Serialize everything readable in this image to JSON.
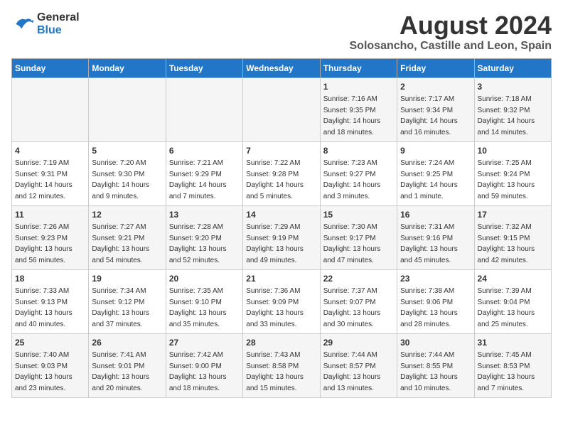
{
  "logo": {
    "line1": "General",
    "line2": "Blue"
  },
  "title": "August 2024",
  "subtitle": "Solosancho, Castille and Leon, Spain",
  "headers": [
    "Sunday",
    "Monday",
    "Tuesday",
    "Wednesday",
    "Thursday",
    "Friday",
    "Saturday"
  ],
  "weeks": [
    [
      {
        "day": "",
        "info": ""
      },
      {
        "day": "",
        "info": ""
      },
      {
        "day": "",
        "info": ""
      },
      {
        "day": "",
        "info": ""
      },
      {
        "day": "1",
        "info": "Sunrise: 7:16 AM\nSunset: 9:35 PM\nDaylight: 14 hours\nand 18 minutes."
      },
      {
        "day": "2",
        "info": "Sunrise: 7:17 AM\nSunset: 9:34 PM\nDaylight: 14 hours\nand 16 minutes."
      },
      {
        "day": "3",
        "info": "Sunrise: 7:18 AM\nSunset: 9:32 PM\nDaylight: 14 hours\nand 14 minutes."
      }
    ],
    [
      {
        "day": "4",
        "info": "Sunrise: 7:19 AM\nSunset: 9:31 PM\nDaylight: 14 hours\nand 12 minutes."
      },
      {
        "day": "5",
        "info": "Sunrise: 7:20 AM\nSunset: 9:30 PM\nDaylight: 14 hours\nand 9 minutes."
      },
      {
        "day": "6",
        "info": "Sunrise: 7:21 AM\nSunset: 9:29 PM\nDaylight: 14 hours\nand 7 minutes."
      },
      {
        "day": "7",
        "info": "Sunrise: 7:22 AM\nSunset: 9:28 PM\nDaylight: 14 hours\nand 5 minutes."
      },
      {
        "day": "8",
        "info": "Sunrise: 7:23 AM\nSunset: 9:27 PM\nDaylight: 14 hours\nand 3 minutes."
      },
      {
        "day": "9",
        "info": "Sunrise: 7:24 AM\nSunset: 9:25 PM\nDaylight: 14 hours\nand 1 minute."
      },
      {
        "day": "10",
        "info": "Sunrise: 7:25 AM\nSunset: 9:24 PM\nDaylight: 13 hours\nand 59 minutes."
      }
    ],
    [
      {
        "day": "11",
        "info": "Sunrise: 7:26 AM\nSunset: 9:23 PM\nDaylight: 13 hours\nand 56 minutes."
      },
      {
        "day": "12",
        "info": "Sunrise: 7:27 AM\nSunset: 9:21 PM\nDaylight: 13 hours\nand 54 minutes."
      },
      {
        "day": "13",
        "info": "Sunrise: 7:28 AM\nSunset: 9:20 PM\nDaylight: 13 hours\nand 52 minutes."
      },
      {
        "day": "14",
        "info": "Sunrise: 7:29 AM\nSunset: 9:19 PM\nDaylight: 13 hours\nand 49 minutes."
      },
      {
        "day": "15",
        "info": "Sunrise: 7:30 AM\nSunset: 9:17 PM\nDaylight: 13 hours\nand 47 minutes."
      },
      {
        "day": "16",
        "info": "Sunrise: 7:31 AM\nSunset: 9:16 PM\nDaylight: 13 hours\nand 45 minutes."
      },
      {
        "day": "17",
        "info": "Sunrise: 7:32 AM\nSunset: 9:15 PM\nDaylight: 13 hours\nand 42 minutes."
      }
    ],
    [
      {
        "day": "18",
        "info": "Sunrise: 7:33 AM\nSunset: 9:13 PM\nDaylight: 13 hours\nand 40 minutes."
      },
      {
        "day": "19",
        "info": "Sunrise: 7:34 AM\nSunset: 9:12 PM\nDaylight: 13 hours\nand 37 minutes."
      },
      {
        "day": "20",
        "info": "Sunrise: 7:35 AM\nSunset: 9:10 PM\nDaylight: 13 hours\nand 35 minutes."
      },
      {
        "day": "21",
        "info": "Sunrise: 7:36 AM\nSunset: 9:09 PM\nDaylight: 13 hours\nand 33 minutes."
      },
      {
        "day": "22",
        "info": "Sunrise: 7:37 AM\nSunset: 9:07 PM\nDaylight: 13 hours\nand 30 minutes."
      },
      {
        "day": "23",
        "info": "Sunrise: 7:38 AM\nSunset: 9:06 PM\nDaylight: 13 hours\nand 28 minutes."
      },
      {
        "day": "24",
        "info": "Sunrise: 7:39 AM\nSunset: 9:04 PM\nDaylight: 13 hours\nand 25 minutes."
      }
    ],
    [
      {
        "day": "25",
        "info": "Sunrise: 7:40 AM\nSunset: 9:03 PM\nDaylight: 13 hours\nand 23 minutes."
      },
      {
        "day": "26",
        "info": "Sunrise: 7:41 AM\nSunset: 9:01 PM\nDaylight: 13 hours\nand 20 minutes."
      },
      {
        "day": "27",
        "info": "Sunrise: 7:42 AM\nSunset: 9:00 PM\nDaylight: 13 hours\nand 18 minutes."
      },
      {
        "day": "28",
        "info": "Sunrise: 7:43 AM\nSunset: 8:58 PM\nDaylight: 13 hours\nand 15 minutes."
      },
      {
        "day": "29",
        "info": "Sunrise: 7:44 AM\nSunset: 8:57 PM\nDaylight: 13 hours\nand 13 minutes."
      },
      {
        "day": "30",
        "info": "Sunrise: 7:44 AM\nSunset: 8:55 PM\nDaylight: 13 hours\nand 10 minutes."
      },
      {
        "day": "31",
        "info": "Sunrise: 7:45 AM\nSunset: 8:53 PM\nDaylight: 13 hours\nand 7 minutes."
      }
    ]
  ],
  "accent_color": "#2176c7"
}
